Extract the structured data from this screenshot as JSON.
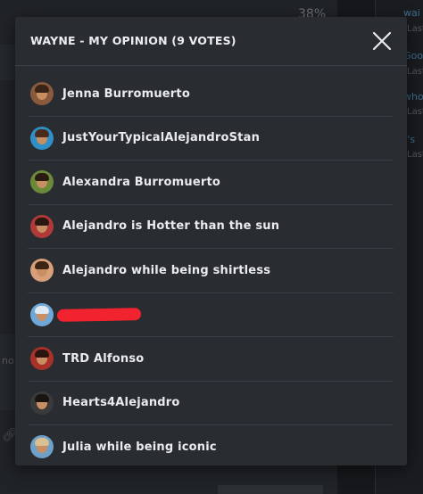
{
  "background": {
    "poll_percent": "38%",
    "side_snippets": [
      "wai",
      "Last",
      "Goo",
      "Last",
      "who",
      "Last",
      "t's",
      "Last"
    ],
    "left_snippet": "no"
  },
  "modal": {
    "title": "WAYNE - MY OPINION (9 VOTES)",
    "close_icon": "close-icon",
    "voters": [
      {
        "name": "Jenna Burromuerto",
        "avatar_color": "#8a5a3c",
        "hair_color": "#3a2418"
      },
      {
        "name": "JustYourTypicalAlejandroStan",
        "avatar_color": "#2f8fc7",
        "hair_color": "#4a2a1a"
      },
      {
        "name": "Alexandra Burromuerto",
        "avatar_color": "#6a8a3a",
        "hair_color": "#2a1a12"
      },
      {
        "name": "Alejandro is Hotter than the sun",
        "avatar_color": "#b03a3a",
        "hair_color": "#2a1810"
      },
      {
        "name": "Alejandro while being shirtless",
        "avatar_color": "#d8a07a",
        "hair_color": "#3a2414"
      },
      {
        "name": "",
        "avatar_color": "#6fa8d8",
        "hair_color": "#e0e8f0",
        "redacted": true
      },
      {
        "name": "TRD Alfonso",
        "avatar_color": "#a8322a",
        "hair_color": "#2a1410"
      },
      {
        "name": "Hearts4Alejandro",
        "avatar_color": "#3a3a3a",
        "hair_color": "#1a1410"
      },
      {
        "name": "Julia while being iconic",
        "avatar_color": "#6fa0c8",
        "hair_color": "#d8c090"
      }
    ]
  }
}
